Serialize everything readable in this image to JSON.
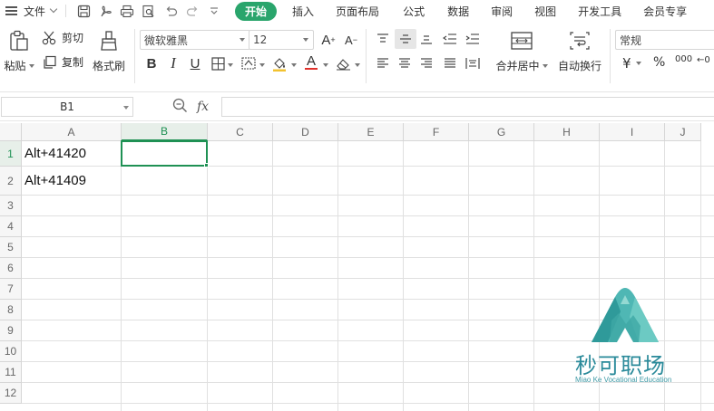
{
  "menubar": {
    "file_label": "文件",
    "tabs": [
      "开始",
      "插入",
      "页面布局",
      "公式",
      "数据",
      "审阅",
      "视图",
      "开发工具",
      "会员专享"
    ],
    "active_tab": "开始"
  },
  "ribbon": {
    "paste_label": "粘贴",
    "cut_label": "剪切",
    "copy_label": "复制",
    "format_painter_label": "格式刷",
    "font_name": "微软雅黑",
    "font_size": "12",
    "merge_center_label": "合并居中",
    "wrap_text_label": "自动换行",
    "number_format": "常规",
    "currency_symbol": "¥",
    "percent_symbol": "%",
    "thousands_symbol": "000",
    "decimal_symbol": "←0"
  },
  "formula_bar": {
    "name_box": "B1",
    "fx_label": "fx",
    "formula": ""
  },
  "sheet": {
    "columns": [
      "A",
      "B",
      "C",
      "D",
      "E",
      "F",
      "G",
      "H",
      "I",
      "J"
    ],
    "rows": [
      "1",
      "2",
      "3",
      "4",
      "5",
      "6",
      "7",
      "8",
      "9",
      "10",
      "11",
      "12"
    ],
    "cells": {
      "A1": "Alt+41420",
      "A2": "Alt+41409"
    },
    "selected_cell": "B1"
  },
  "watermark": {
    "title": "秒可职场",
    "subtitle": "Miao Ke Vocational Education",
    "color": "#2a8a9a"
  },
  "colors": {
    "accent": "#2aa56c",
    "selection": "#1f9154"
  }
}
